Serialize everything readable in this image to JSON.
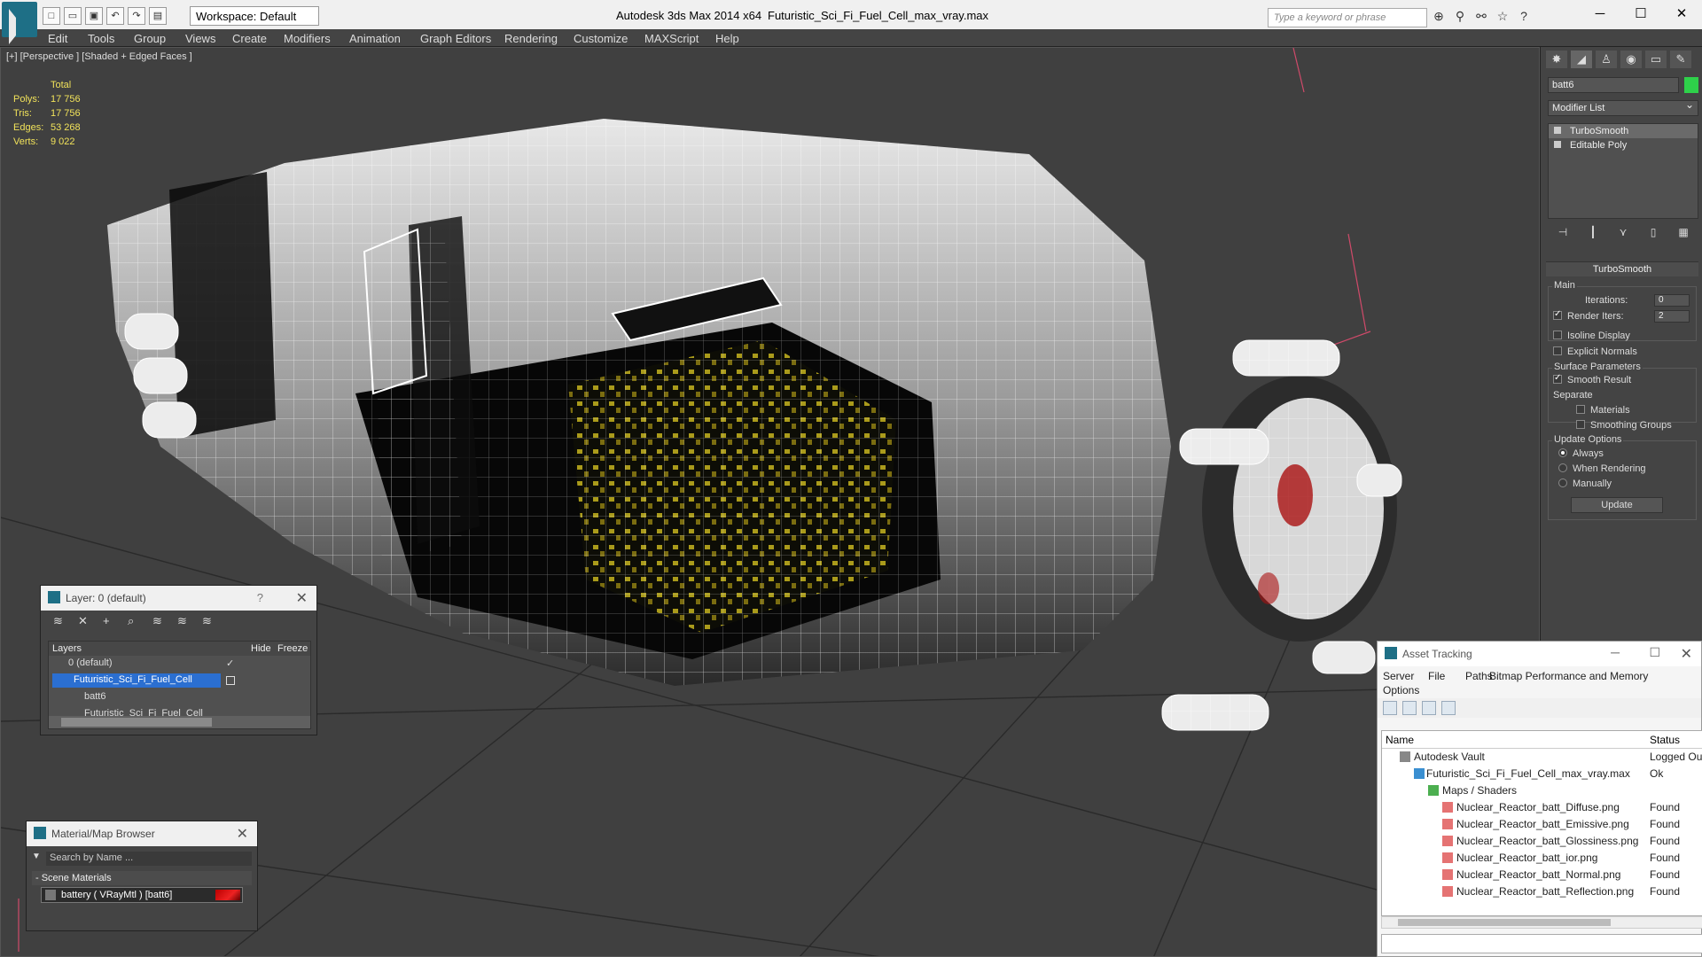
{
  "titlebar": {
    "app_title": "Autodesk 3ds Max  2014 x64",
    "file_title": "Futuristic_Sci_Fi_Fuel_Cell_max_vray.max",
    "workspace_label": "Workspace: Default",
    "search_placeholder": "Type a keyword or phrase"
  },
  "menu": [
    "Edit",
    "Tools",
    "Group",
    "Views",
    "Create",
    "Modifiers",
    "Animation",
    "Graph Editors",
    "Rendering",
    "Customize",
    "MAXScript",
    "Help"
  ],
  "viewport": {
    "label": "[+] [Perspective ] [Shaded + Edged Faces ]",
    "stats": {
      "header": "Total",
      "polys_label": "Polys:",
      "polys": "17 756",
      "tris_label": "Tris:",
      "tris": "17 756",
      "edges_label": "Edges:",
      "edges": "53 268",
      "verts_label": "Verts:",
      "verts": "9 022"
    }
  },
  "command_panel": {
    "object_name": "batt6",
    "object_color": "#2ed14a",
    "modifier_list": "Modifier List",
    "stack": [
      "TurboSmooth",
      "Editable Poly"
    ],
    "rollout_title": "TurboSmooth",
    "main_group": "Main",
    "iterations_label": "Iterations:",
    "iterations": "0",
    "render_iters_label": "Render Iters:",
    "render_iters": "2",
    "render_iters_checked": true,
    "isoline_label": "Isoline Display",
    "explicit_normals_label": "Explicit Normals",
    "surface_group": "Surface Parameters",
    "smooth_result_label": "Smooth Result",
    "separate_label": "Separate",
    "materials_label": "Materials",
    "smoothing_groups_label": "Smoothing Groups",
    "update_group": "Update Options",
    "always_label": "Always",
    "when_rendering_label": "When Rendering",
    "manually_label": "Manually",
    "update_button": "Update"
  },
  "layer_window": {
    "title": "Layer: 0 (default)",
    "help": "?",
    "col_layers": "Layers",
    "col_hide": "Hide",
    "col_freeze": "Freeze",
    "rows": [
      {
        "name": "0 (default)"
      },
      {
        "name": "Futuristic_Sci_Fi_Fuel_Cell"
      },
      {
        "name": "batt6"
      },
      {
        "name": "Futuristic_Sci_Fi_Fuel_Cell"
      }
    ]
  },
  "material_browser": {
    "title": "Material/Map Browser",
    "search_placeholder": "Search by Name ...",
    "category": "- Scene Materials",
    "item": "battery  ( VRayMtl )  [batt6]"
  },
  "asset_tracking": {
    "title": "Asset Tracking",
    "menu": [
      "Server",
      "File",
      "Paths",
      "Bitmap Performance and Memory",
      "Options"
    ],
    "col_name": "Name",
    "col_status": "Status",
    "rows": [
      {
        "name": "Autodesk Vault",
        "status": "Logged Ou"
      },
      {
        "name": "Futuristic_Sci_Fi_Fuel_Cell_max_vray.max",
        "status": "Ok"
      },
      {
        "name": "Maps / Shaders",
        "status": ""
      },
      {
        "name": "Nuclear_Reactor_batt_Diffuse.png",
        "status": "Found"
      },
      {
        "name": "Nuclear_Reactor_batt_Emissive.png",
        "status": "Found"
      },
      {
        "name": "Nuclear_Reactor_batt_Glossiness.png",
        "status": "Found"
      },
      {
        "name": "Nuclear_Reactor_batt_ior.png",
        "status": "Found"
      },
      {
        "name": "Nuclear_Reactor_batt_Normal.png",
        "status": "Found"
      },
      {
        "name": "Nuclear_Reactor_batt_Reflection.png",
        "status": "Found"
      }
    ]
  }
}
